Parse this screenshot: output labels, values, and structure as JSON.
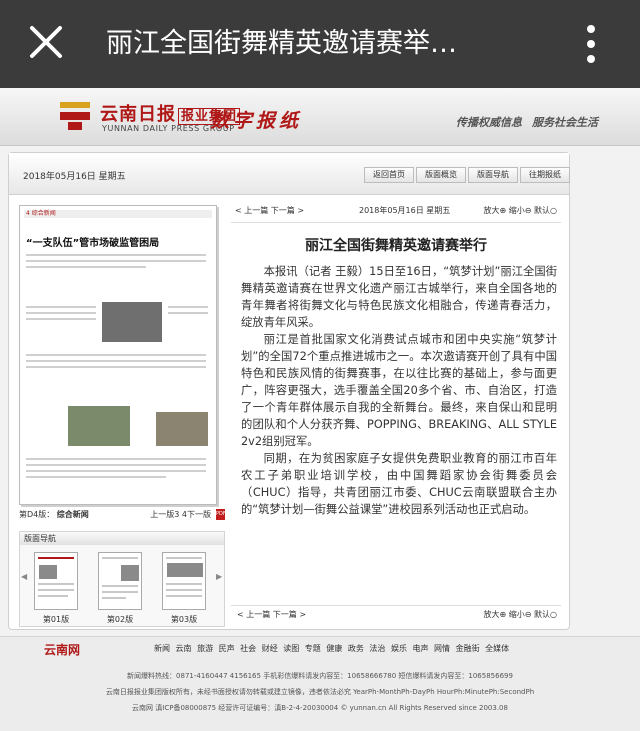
{
  "topbar": {
    "title": "丽江全国街舞精英邀请赛举…"
  },
  "header": {
    "logo_cn": "云南日报",
    "logo_sub": "报业集团",
    "logo_en": "YUNNAN DAILY PRESS GROUP",
    "digital": "数字报纸",
    "slogan1": "传播权威信息",
    "slogan2": "服务社会生活"
  },
  "panel": {
    "date": "2018年05月16日 星期五",
    "tabs": [
      "返回首页",
      "版面概览",
      "版面导航",
      "往期报纸"
    ]
  },
  "thumb": {
    "section": "4 综合新闻",
    "headline": "“一支队伍”管市场破监管困局",
    "page_label": "第D4版：",
    "page_name": "综合新闻",
    "page_nav": "上一版3  4下一版"
  },
  "article": {
    "nav": "< 上一篇  下一篇 >",
    "date": "2018年05月16日 星期五",
    "zoom": "放大⊕ 缩小⊖ 默认○",
    "title": "丽江全国街舞精英邀请赛举行",
    "paragraphs": [
      "本报讯（记者 王毅）15日至16日，“筑梦计划”丽江全国街舞精英邀请赛在世界文化遗产丽江古城举行，来自全国各地的青年舞者将街舞文化与特色民族文化相融合，传递青春活力，绽放青年风采。",
      "丽江是首批国家文化消费试点城市和团中央实施“筑梦计划”的全国72个重点推进城市之一。本次邀请赛开创了具有中国特色和民族风情的街舞赛事，在以往比赛的基础上，参与面更广，阵容更强大，选手覆盖全国20多个省、市、自治区，打造了一个青年群体展示自我的全新舞台。最终，来自保山和昆明的团队和个人分获齐舞、POPPING、BREAKING、ALL STYLE 2v2组别冠军。",
      "同期，在为贫困家庭子女提供免费职业教育的丽江市百年农工子弟职业培训学校，由中国舞蹈家协会街舞委员会（CHUC）指导，共青团丽江市委、CHUC云南联盟联合主办的“筑梦计划—街舞公益课堂”进校园系列活动也正式启动。"
    ],
    "foot_nav": "< 上一篇  下一篇 >",
    "foot_zoom": "放大⊕ 缩小⊖ 默认○"
  },
  "pagenav": {
    "header": "版面导航",
    "pages": [
      "第01版",
      "第02版",
      "第03版"
    ]
  },
  "footer": {
    "logo": "云南网",
    "nav": "新闻 云南 旅游 民声 社会 财经 读图 专题 健康 政务 法治 娱乐 电声 网情 金融街 全媒体",
    "line1": "新闻爆料热线：0871-4160447 4156165 手机彩信爆料请发内容至：10658666780 短信爆料请发内容至：1065856699",
    "line2": "云南日报报业集团版权所有，未经书面授权请勿转载或建立镜像，违者依法必究 YearPh-MonthPh-DayPh HourPh:MinutePh:SecondPh",
    "line3": "云南网  滇ICP备08000875  经营许可证编号：滇B-2-4-20030004 © yunnan.cn All Rights Reserved since 2003.08"
  }
}
